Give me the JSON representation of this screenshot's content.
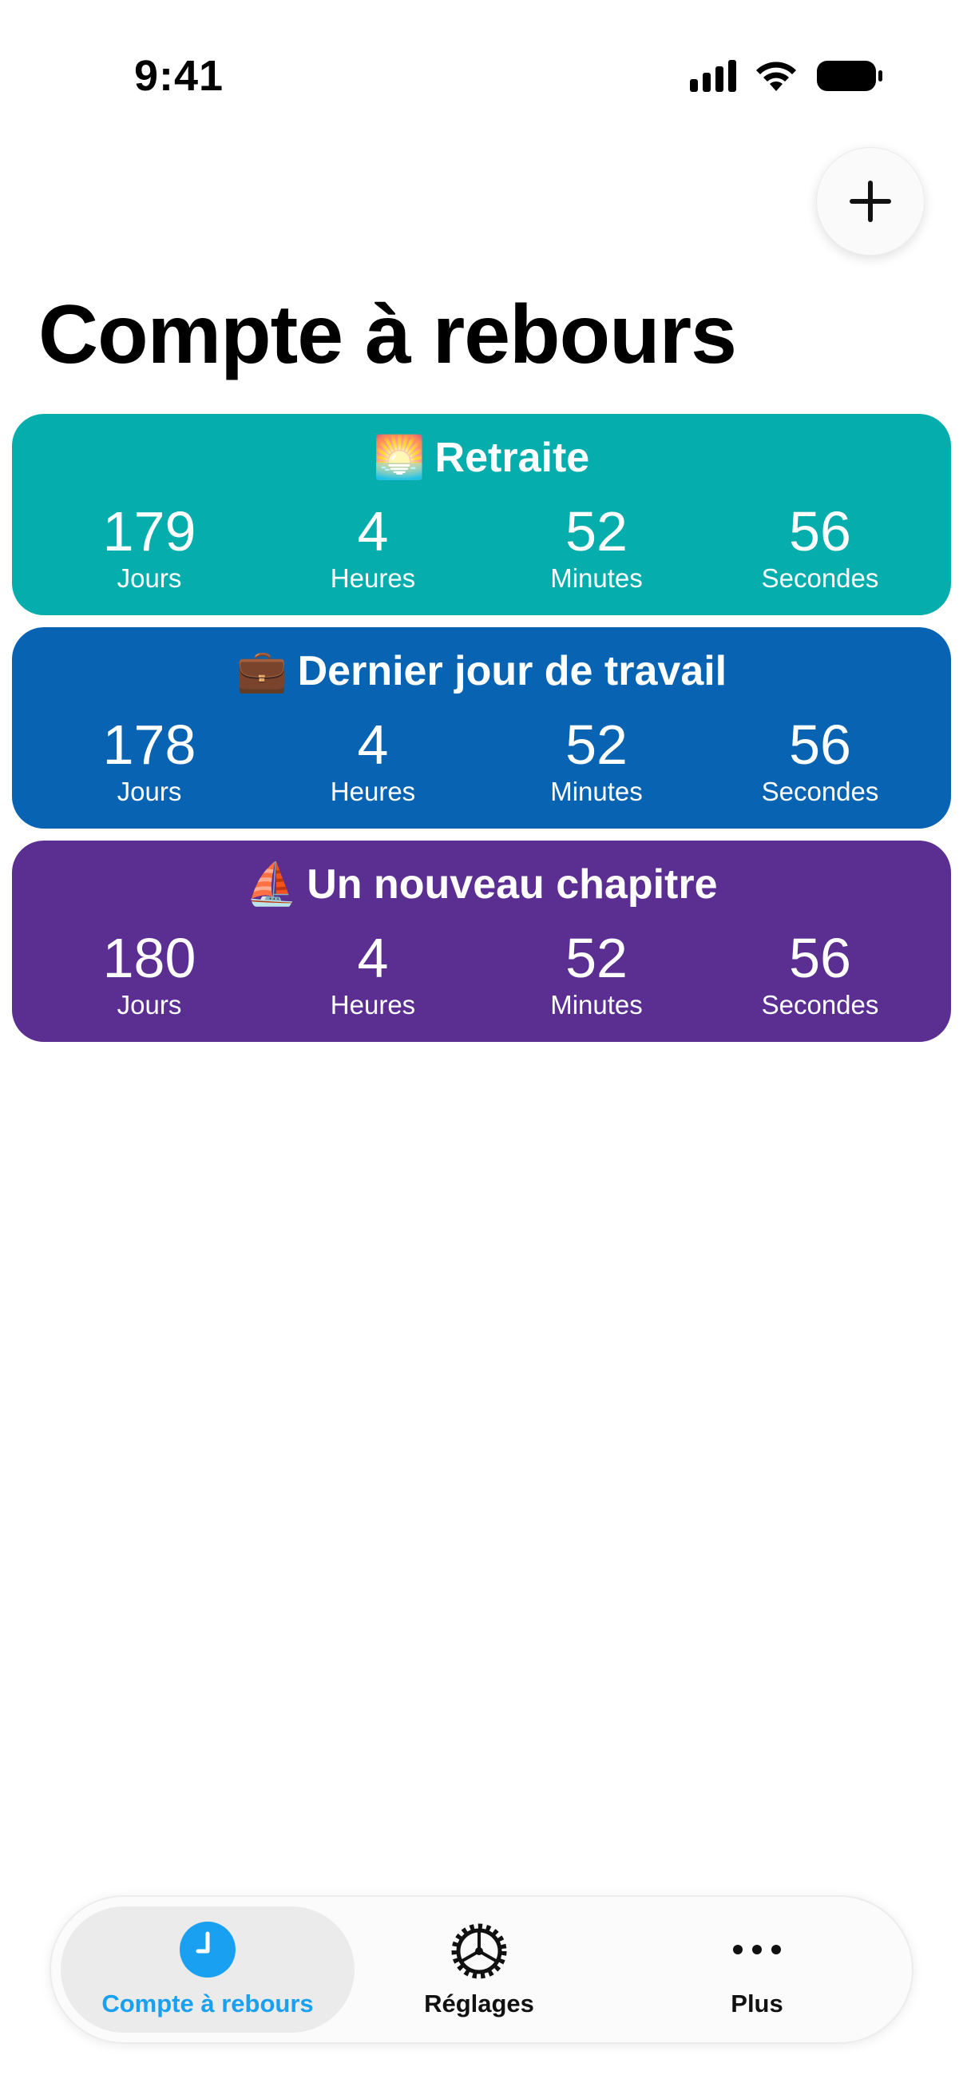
{
  "status_bar": {
    "time": "9:41"
  },
  "header": {
    "title": "Compte à rebours",
    "add_icon": "plus-icon"
  },
  "countdowns": [
    {
      "emoji": "🌅",
      "title": "Retraite",
      "color": "#06ADAD",
      "days": "179",
      "hours": "4",
      "minutes": "52",
      "seconds": "56"
    },
    {
      "emoji": "💼",
      "title": "Dernier jour de travail",
      "color": "#0864B3",
      "days": "178",
      "hours": "4",
      "minutes": "52",
      "seconds": "56"
    },
    {
      "emoji": "⛵",
      "title": "Un nouveau chapitre",
      "color": "#5A2F91",
      "days": "180",
      "hours": "4",
      "minutes": "52",
      "seconds": "56"
    }
  ],
  "unit_labels": {
    "days": "Jours",
    "hours": "Heures",
    "minutes": "Minutes",
    "seconds": "Secondes"
  },
  "tab_bar": {
    "active_color": "#1AA0F0",
    "tabs": [
      {
        "label": "Compte à rebours",
        "icon": "clock-icon",
        "active": true
      },
      {
        "label": "Réglages",
        "icon": "gear-icon",
        "active": false
      },
      {
        "label": "Plus",
        "icon": "more-icon",
        "active": false
      }
    ]
  }
}
